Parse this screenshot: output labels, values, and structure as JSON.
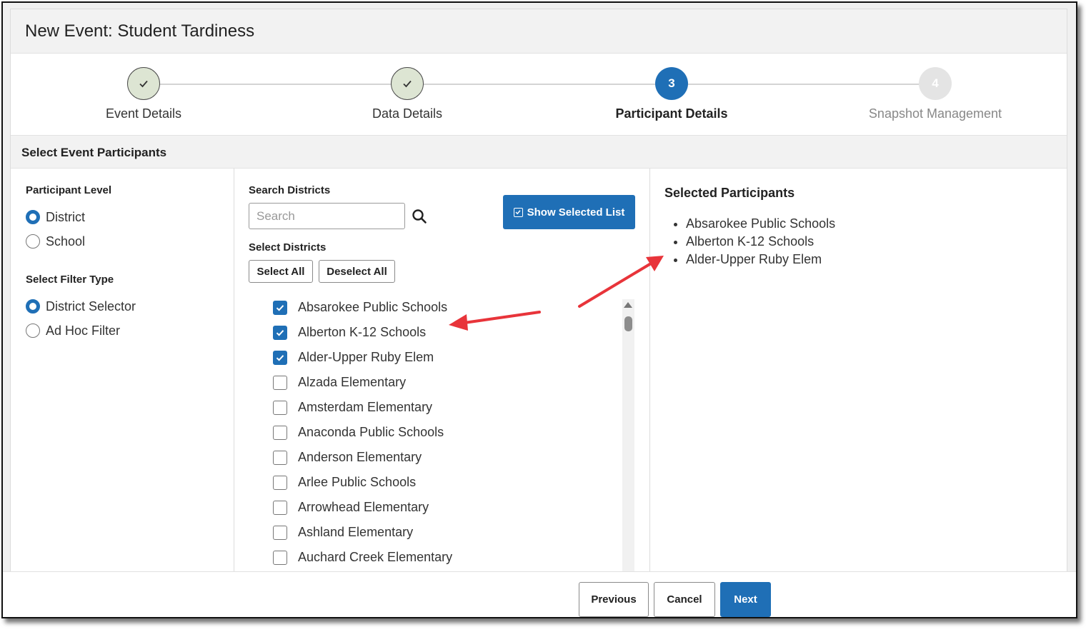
{
  "dialog": {
    "title": "New Event: Student Tardiness"
  },
  "steps": [
    {
      "label": "Event Details",
      "state": "done",
      "number": ""
    },
    {
      "label": "Data Details",
      "state": "done",
      "number": ""
    },
    {
      "label": "Participant Details",
      "state": "active",
      "number": "3"
    },
    {
      "label": "Snapshot Management",
      "state": "pending",
      "number": "4"
    }
  ],
  "section": {
    "title": "Select Event Participants"
  },
  "participant_level": {
    "label": "Participant Level",
    "options": [
      {
        "label": "District",
        "selected": true
      },
      {
        "label": "School",
        "selected": false
      }
    ]
  },
  "filter_type": {
    "label": "Select Filter Type",
    "options": [
      {
        "label": "District Selector",
        "selected": true
      },
      {
        "label": "Ad Hoc Filter",
        "selected": false
      }
    ]
  },
  "search": {
    "label": "Search Districts",
    "placeholder": "Search",
    "value": ""
  },
  "show_selected_label": "Show Selected List",
  "districts": {
    "label": "Select Districts",
    "select_all": "Select All",
    "deselect_all": "Deselect All",
    "items": [
      {
        "name": "Absarokee Public Schools",
        "checked": true
      },
      {
        "name": "Alberton K-12 Schools",
        "checked": true
      },
      {
        "name": "Alder-Upper Ruby Elem",
        "checked": true
      },
      {
        "name": "Alzada Elementary",
        "checked": false
      },
      {
        "name": "Amsterdam Elementary",
        "checked": false
      },
      {
        "name": "Anaconda Public Schools",
        "checked": false
      },
      {
        "name": "Anderson Elementary",
        "checked": false
      },
      {
        "name": "Arlee Public Schools",
        "checked": false
      },
      {
        "name": "Arrowhead Elementary",
        "checked": false
      },
      {
        "name": "Ashland Elementary",
        "checked": false
      },
      {
        "name": "Auchard Creek Elementary",
        "checked": false
      }
    ]
  },
  "selected": {
    "title": "Selected Participants",
    "items": [
      "Absarokee Public Schools",
      "Alberton K-12 Schools",
      "Alder-Upper Ruby Elem"
    ]
  },
  "footer": {
    "previous": "Previous",
    "cancel": "Cancel",
    "next": "Next"
  },
  "colors": {
    "primary": "#1f6fb6",
    "done_step": "#dde5d3",
    "annotation_arrow": "#e8343a"
  }
}
